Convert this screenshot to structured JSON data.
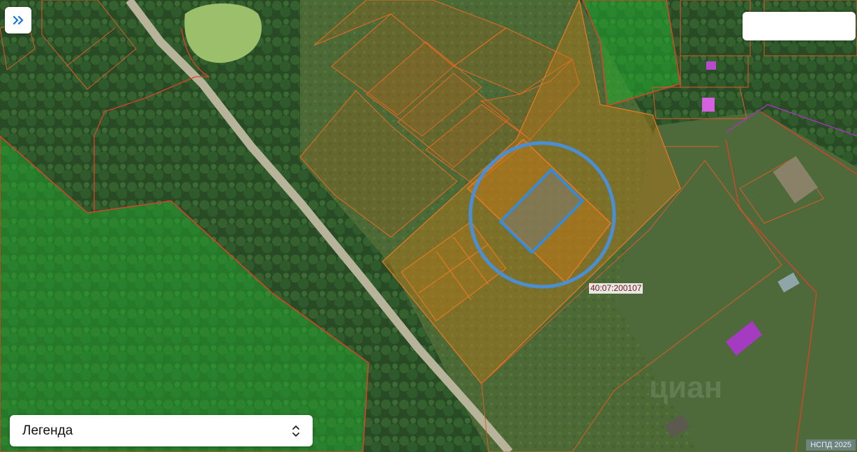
{
  "map": {
    "base_layer": "satellite",
    "parcel_outline_color": "#e0402a",
    "forest_zone_color": "#1fa82e",
    "highlight_parcel_color": "#d07a18",
    "selected_parcel_color": "#1e90ff",
    "search_circle_color": "#4a8fd6",
    "parcel_label": "40:07:200107",
    "top_label": "· · · · · · · · · ·"
  },
  "controls": {
    "expand_icon": "double-chevron-right-icon",
    "search_placeholder": "",
    "legend_label": "Легенда",
    "legend_icon": "up-down-chevron-icon"
  },
  "attribution": "НСПД 2025"
}
